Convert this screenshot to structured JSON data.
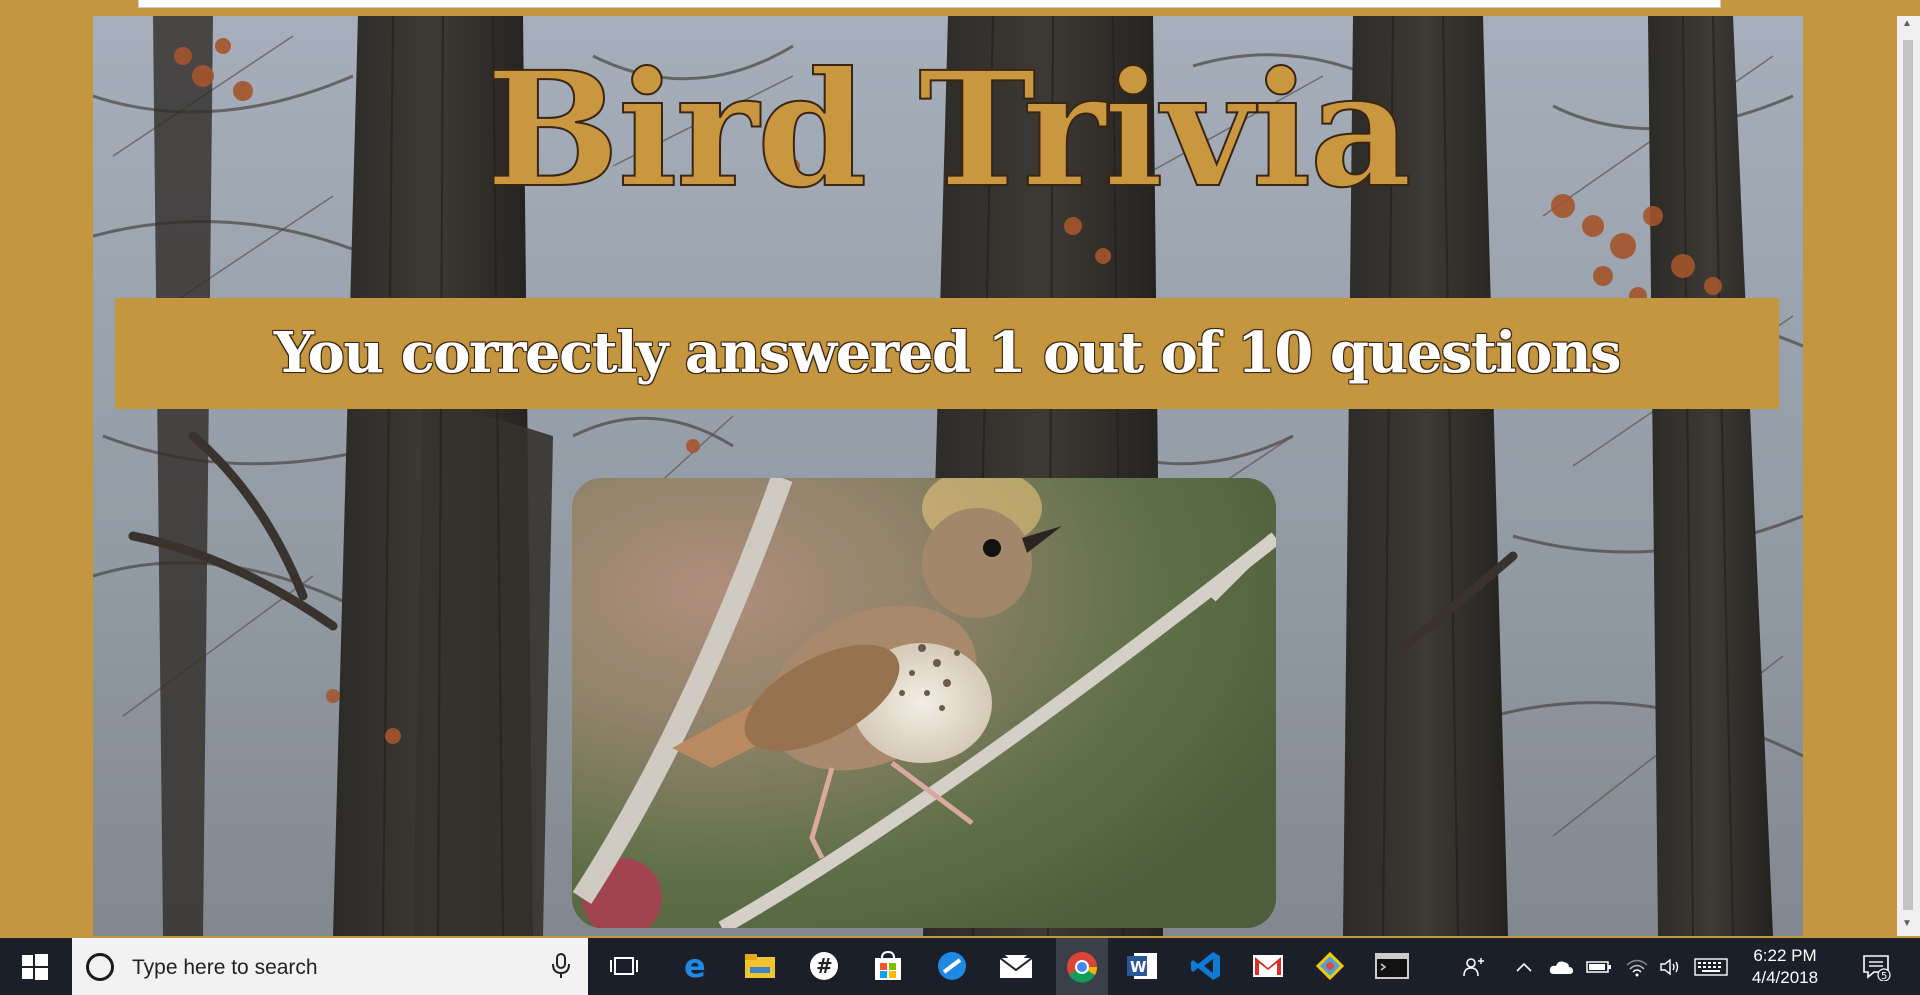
{
  "page": {
    "title": "Bird Trivia",
    "result_text": "You correctly answered 1 out of 10 questions",
    "photo_subject": "thrush-on-branch"
  },
  "colors": {
    "gold": "#c4963f",
    "title_fill": "#c8973f",
    "title_outline": "#3a2412",
    "banner_text": "#ffffff",
    "taskbar": "#1b1f2a"
  },
  "taskbar": {
    "search_placeholder": "Type here to search",
    "apps": [
      {
        "icon": "task-view-icon"
      },
      {
        "icon": "edge-icon"
      },
      {
        "icon": "file-explorer-icon"
      },
      {
        "icon": "slack-icon"
      },
      {
        "icon": "store-icon"
      },
      {
        "icon": "browser-compass-icon"
      },
      {
        "icon": "mail-icon"
      },
      {
        "icon": "chrome-icon",
        "active": true
      },
      {
        "icon": "word-icon"
      },
      {
        "icon": "vscode-icon"
      },
      {
        "icon": "gmail-icon"
      },
      {
        "icon": "git-icon"
      },
      {
        "icon": "terminal-icon"
      }
    ],
    "tray_icons": [
      "people-icon",
      "chevron-up-icon",
      "onedrive-icon",
      "battery-icon",
      "wifi-icon",
      "volume-icon",
      "keyboard-icon"
    ],
    "time": "6:22 PM",
    "date": "4/4/2018",
    "notification_count": "5"
  }
}
